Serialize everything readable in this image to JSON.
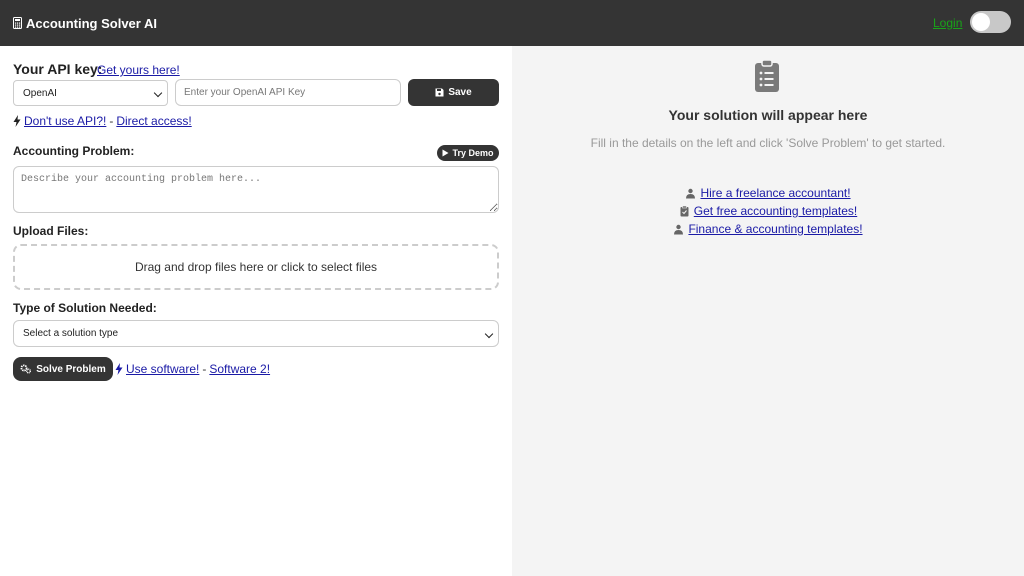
{
  "header": {
    "title": "Accounting Solver AI",
    "login_label": "Login"
  },
  "api": {
    "title": "Your API key:",
    "get_link": "Get yours here!",
    "provider_selected": "OpenAI",
    "key_placeholder": "Enter your OpenAI API Key",
    "save_label": "Save",
    "no_api_link": "Don't use API?!",
    "separator": "-",
    "direct_link": "Direct access!"
  },
  "problem": {
    "label": "Accounting Problem:",
    "demo_label": "Try Demo",
    "placeholder": "Describe your accounting problem here..."
  },
  "upload": {
    "label": "Upload Files:",
    "dropzone_text": "Drag and drop files here or click to select files"
  },
  "solution_type": {
    "label": "Type of Solution Needed:",
    "selected": "Select a solution type"
  },
  "actions": {
    "solve_label": "Solve Problem",
    "software_link": "Use software!",
    "separator": "-",
    "software2_link": "Software 2!"
  },
  "result": {
    "title": "Your solution will appear here",
    "subtitle": "Fill in the details on the left and click 'Solve Problem' to get started.",
    "links": [
      {
        "icon": "accountant-icon",
        "label": "Hire a freelance accountant!"
      },
      {
        "icon": "clipboard-icon",
        "label": "Get free accounting templates!"
      },
      {
        "icon": "accountant-icon",
        "label": "Finance & accounting templates!"
      }
    ]
  },
  "colors": {
    "header_bg": "#343434",
    "login": "#18a418",
    "link": "#1a1aa6",
    "right_panel_bg": "#f4f4f4"
  }
}
